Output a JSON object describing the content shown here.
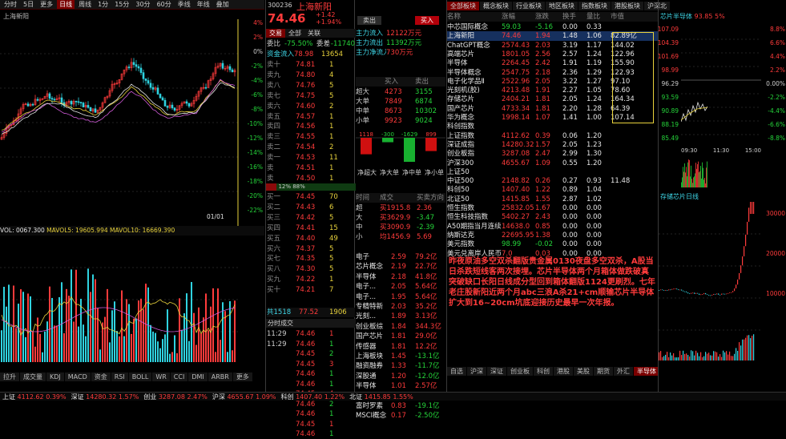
{
  "toolbar": {
    "tabs": [
      "分时",
      "5日",
      "更多",
      "日线",
      "周线",
      "1分",
      "15分",
      "30分",
      "60分",
      "季线",
      "年线"
    ],
    "active": "日线",
    "label": "叠加"
  },
  "chart": {
    "stock_label": "上海新阳",
    "volume_label": "VOL: 0067.300",
    "ma_labels": "MAVOL5: 19605.994 MAVOL10: 16669.390",
    "right_axis": [
      "4%",
      "2%",
      "0%",
      "-2%",
      "-4%",
      "-6%",
      "-8%",
      "-10%",
      "-12%",
      "-14%",
      "-16%",
      "-18%",
      "-20%",
      "-22%"
    ],
    "date_tag": "01/01",
    "bottom_tabs": [
      "拉升",
      "成交量",
      "KDJ",
      "MACD",
      "资金",
      "RSI",
      "BOLL",
      "WR",
      "CCI",
      "DMI",
      "ARBR",
      "更多"
    ],
    "price_tag": "112.62"
  },
  "quote": {
    "code": "300236",
    "name": "上海新阳",
    "price": "74.46",
    "change": "+1.42",
    "pct": "+1.94%",
    "btn_buy": "买入",
    "btn_sell": "卖出",
    "tabs": [
      "交易",
      "全部",
      "关联"
    ],
    "ratio_label": "委比",
    "ratio": "-75.50%",
    "diff_label": "委差",
    "diff": "-11740",
    "board_label": "资金流入",
    "board_value": "78.98",
    "vol_label": "13654",
    "flow_rows": [
      {
        "label": "主力流入",
        "val": "12122万元"
      },
      {
        "label": "主力流出",
        "val": "11392万元"
      },
      {
        "label": "主力净流入",
        "val": "730万元"
      }
    ],
    "asks": [
      {
        "l": "卖十",
        "p": "74.81",
        "v": "1"
      },
      {
        "l": "卖九",
        "p": "74.80",
        "v": "4"
      },
      {
        "l": "卖八",
        "p": "74.76",
        "v": "5"
      },
      {
        "l": "卖七",
        "p": "74.75",
        "v": "5"
      },
      {
        "l": "卖六",
        "p": "74.60",
        "v": "2"
      },
      {
        "l": "卖五",
        "p": "74.57",
        "v": "1"
      },
      {
        "l": "卖四",
        "p": "74.56",
        "v": "1"
      },
      {
        "l": "卖三",
        "p": "74.55",
        "v": "1"
      },
      {
        "l": "卖二",
        "p": "74.54",
        "v": "2"
      },
      {
        "l": "卖一",
        "p": "74.53",
        "v": "11"
      },
      {
        "l": "卖",
        "p": "74.51",
        "v": "1"
      },
      {
        "l": "卖",
        "p": "74.50",
        "v": "1"
      }
    ],
    "bids": [
      {
        "l": "买一",
        "p": "74.45",
        "v": "70"
      },
      {
        "l": "买二",
        "p": "74.43",
        "v": "6"
      },
      {
        "l": "买三",
        "p": "74.42",
        "v": "5"
      },
      {
        "l": "买四",
        "p": "74.41",
        "v": "15"
      },
      {
        "l": "买五",
        "p": "74.40",
        "v": "49"
      },
      {
        "l": "买六",
        "p": "74.37",
        "v": "5"
      },
      {
        "l": "买七",
        "p": "74.35",
        "v": "5"
      },
      {
        "l": "买八",
        "p": "74.30",
        "v": "5"
      },
      {
        "l": "买九",
        "p": "74.22",
        "v": "1"
      },
      {
        "l": "买十",
        "p": "74.21",
        "v": "7"
      }
    ],
    "mid_bar": "12% 88%",
    "sum_label": "共1518",
    "sum_p": "77.52",
    "sum_v": "1906",
    "trade_label": "分时成交",
    "trades": [
      {
        "t": "11:29",
        "p": "74.46",
        "v": "1"
      },
      {
        "t": "11:29",
        "p": "74.46",
        "v": "1"
      },
      {
        "t": "",
        "p": "74.45",
        "v": "2"
      },
      {
        "t": "",
        "p": "74.45",
        "v": "3"
      },
      {
        "t": "",
        "p": "74.46",
        "v": "1"
      },
      {
        "t": "",
        "p": "74.46",
        "v": "1"
      },
      {
        "t": "",
        "p": "74.45",
        "v": "4"
      },
      {
        "t": "",
        "p": "74.46",
        "v": "2"
      },
      {
        "t": "",
        "p": "74.46",
        "v": "1"
      },
      {
        "t": "",
        "p": "74.45",
        "v": "1"
      },
      {
        "t": "",
        "p": "74.46",
        "v": "1"
      }
    ]
  },
  "flow": {
    "header": [
      "买入",
      "卖出"
    ],
    "rows": [
      {
        "l": "超大",
        "a": "4273",
        "b": "3155"
      },
      {
        "l": "大单",
        "a": "7849",
        "b": "6874"
      },
      {
        "l": "中单",
        "a": "8673",
        "b": "10302"
      },
      {
        "l": "小单",
        "a": "9923",
        "b": "9024"
      }
    ],
    "bars": [
      {
        "label": "1118",
        "v": "1118"
      },
      {
        "label": "-300",
        "v": "-300"
      },
      {
        "label": "-1629",
        "v": "-1629"
      },
      {
        "label": "899",
        "v": "899"
      }
    ],
    "bar_labels": [
      "净超大",
      "净大单",
      "净中单",
      "净小单"
    ],
    "dir_header": [
      "时间",
      "成交",
      "买卖方向"
    ],
    "dir_rows": [
      {
        "a": "超",
        "b": "买1915.8",
        "c": "2.36"
      },
      {
        "a": "大",
        "b": "买3629.9",
        "c": "-3.47"
      },
      {
        "a": "中",
        "b": "买3090.9",
        "c": "-2.39"
      },
      {
        "a": "小",
        "b": "均1456.9",
        "c": "5.69"
      }
    ],
    "sector_rows": [
      {
        "n": "电子",
        "a": "2.59",
        "b": "79.2亿"
      },
      {
        "n": "芯片概念",
        "a": "2.19",
        "b": "22.7亿"
      },
      {
        "n": "半导体",
        "a": "2.18",
        "b": "41.8亿"
      },
      {
        "n": "电子...",
        "a": "2.05",
        "b": "5.64亿"
      },
      {
        "n": "电子...",
        "a": "1.95",
        "b": "5.64亿"
      },
      {
        "n": "专精特新",
        "a": "2.03",
        "b": "35.2亿"
      },
      {
        "n": "光刻...",
        "a": "1.89",
        "b": "3.13亿"
      },
      {
        "n": "创业板综",
        "a": "1.84",
        "b": "344.3亿"
      },
      {
        "n": "国产芯片",
        "a": "1.81",
        "b": "29.0亿"
      },
      {
        "n": "传感器",
        "a": "1.81",
        "b": "12.2亿"
      },
      {
        "n": "上海板块",
        "a": "1.45",
        "b": "-13.1亿"
      },
      {
        "n": "融资融券",
        "a": "1.33",
        "b": "-11.7亿"
      },
      {
        "n": "深股通",
        "a": "1.20",
        "b": "-12.0亿"
      },
      {
        "n": "半导体",
        "a": "1.01",
        "b": "2.57亿"
      },
      {
        "n": "小盘股",
        "a": "0.97",
        "b": "-15.5亿"
      },
      {
        "n": "富时罗素",
        "a": "0.83",
        "b": "-19.1亿"
      },
      {
        "n": "MSCI概念",
        "a": "0.17",
        "b": "-2.50亿"
      }
    ]
  },
  "sectors": {
    "tabs": [
      "全部板块",
      "概念板块",
      "行业板块",
      "地区板块",
      "指数板块",
      "港股板块",
      "沪深北"
    ],
    "header": [
      "名称",
      "涨幅",
      "涨跌",
      "换手",
      "量比",
      "市值"
    ],
    "rows": [
      {
        "n": "中芯国际概念",
        "a": "59.03",
        "b": "-5.16",
        "c": "0.00",
        "d": "0.33",
        "e": ""
      },
      {
        "n": "上海新阳",
        "a": "74.46",
        "b": "1.94",
        "c": "1.48",
        "d": "1.06",
        "e": "82.89亿"
      },
      {
        "n": "ChatGPT概念",
        "a": "2574.43",
        "b": "2.03",
        "c": "3.19",
        "d": "1.17",
        "e": "144.02"
      },
      {
        "n": "高端芯片",
        "a": "1801.05",
        "b": "2.56",
        "c": "2.57",
        "d": "1.24",
        "e": "122.96"
      },
      {
        "n": "半导体",
        "a": "2264.45",
        "b": "2.42",
        "c": "1.91",
        "d": "1.19",
        "e": "155.90"
      },
      {
        "n": "半导体概念",
        "a": "2547.75",
        "b": "2.18",
        "c": "2.36",
        "d": "1.29",
        "e": "122.93"
      },
      {
        "n": "电子化学品Ⅱ",
        "a": "2522.96",
        "b": "2.05",
        "c": "3.22",
        "d": "1.27",
        "e": "97.10"
      },
      {
        "n": "光刻机(胶)",
        "a": "4213.48",
        "b": "1.91",
        "c": "2.27",
        "d": "1.05",
        "e": "78.60"
      },
      {
        "n": "存储芯片",
        "a": "2404.21",
        "b": "1.81",
        "c": "2.05",
        "d": "1.24",
        "e": "164.34"
      },
      {
        "n": "国产芯片",
        "a": "4733.34",
        "b": "1.81",
        "c": "2.20",
        "d": "1.28",
        "e": "64.39"
      },
      {
        "n": "华为概念",
        "a": "1998.14",
        "b": "1.07",
        "c": "1.41",
        "d": "1.00",
        "e": "107.14"
      },
      {
        "n": "科创指数",
        "a": "",
        "b": "",
        "c": "",
        "d": "",
        "e": ""
      },
      {
        "n": "上证指数",
        "a": "4112.62",
        "b": "0.39",
        "c": "0.06",
        "d": "1.20",
        "e": ""
      },
      {
        "n": "深证成指",
        "a": "14280.32",
        "b": "1.57",
        "c": "2.05",
        "d": "1.23",
        "e": ""
      },
      {
        "n": "创业板指",
        "a": "3287.08",
        "b": "2.47",
        "c": "2.99",
        "d": "1.30",
        "e": ""
      },
      {
        "n": "沪深300",
        "a": "4655.67",
        "b": "1.09",
        "c": "0.55",
        "d": "1.20",
        "e": ""
      },
      {
        "n": "上证50",
        "a": "",
        "b": "",
        "c": "",
        "d": "",
        "e": ""
      },
      {
        "n": "中证500",
        "a": "2148.82",
        "b": "0.26",
        "c": "0.27",
        "d": "0.93",
        "e": "11.48"
      },
      {
        "n": "科创50",
        "a": "1407.40",
        "b": "1.22",
        "c": "0.89",
        "d": "1.04",
        "e": ""
      },
      {
        "n": "北证50",
        "a": "1415.85",
        "b": "1.55",
        "c": "2.87",
        "d": "1.02",
        "e": ""
      },
      {
        "n": "恒生指数",
        "a": "25832.05",
        "b": "1.67",
        "d": "0.00",
        "c": "0.00",
        "e": ""
      },
      {
        "n": "恒生科技指数",
        "a": "5402.27",
        "b": "2.43",
        "c": "0.00",
        "d": "0.00",
        "e": ""
      },
      {
        "n": "A50期指当月连续",
        "a": "14638.0",
        "b": "0.85",
        "c": "0.00",
        "d": "0.00",
        "e": ""
      },
      {
        "n": "纳斯达克",
        "a": "22695.95",
        "b": "1.38",
        "c": "0.00",
        "d": "0.00",
        "e": ""
      },
      {
        "n": "美元指数",
        "a": "98.99",
        "b": "-0.02",
        "c": "0.00",
        "d": "0.00",
        "e": ""
      },
      {
        "n": "美元兑离岸人民币",
        "a": "7.0",
        "b": "0.03",
        "c": "0.00",
        "d": "0.00",
        "e": ""
      }
    ],
    "bottom_tabs": [
      "自选",
      "沪深",
      "深证",
      "创业板",
      "科创",
      "港股",
      "美股",
      "期货",
      "外汇",
      "半导体",
      "更多"
    ],
    "annotation": "昨夜原油多空双杀翻版贵金属0130夜盘多空双杀，A股当日杀跌短线客两次接埋。芯片半导体两个月箱体做跌破真突破缺口长阳日线成分型回到箱体翻版1124更刷烈。七年老庄股新阳近两个月abc三浪A杀21+cm顺输芯片半导体扩大到16~20cm坑底迎接历史最早一次年报。"
  },
  "mini": {
    "title": "芯片半导体",
    "value": "93.85",
    "pct": "5%",
    "right_axis": [
      "8.8%",
      "6.6%",
      "4.4%",
      "2.2%",
      "0.00%",
      "-2.2%",
      "-4.4%",
      "-6.6%",
      "-8.8%"
    ],
    "left_axis": [
      "107.09",
      "104.39",
      "101.69",
      "98.99",
      "96.29",
      "93.59",
      "90.89",
      "88.19",
      "85.49"
    ],
    "time_labels": [
      "09:30",
      "11:30",
      "15:00"
    ],
    "sub_title": "存储芯片日线",
    "sub_axis": [
      "30000",
      "20000",
      "10000"
    ]
  },
  "status": {
    "items": [
      {
        "t": "上证",
        "v": "4112.62",
        "c": "0.39%"
      },
      {
        "t": "深证",
        "v": "14280.32",
        "c": "1.57%"
      },
      {
        "t": "创业",
        "v": "3287.08",
        "c": "2.47%"
      },
      {
        "t": "沪深",
        "v": "4655.67",
        "c": "1.09%"
      },
      {
        "t": "科创",
        "v": "1407.40",
        "c": "1.22%"
      },
      {
        "t": "北证",
        "v": "1415.85",
        "c": "1.55%"
      }
    ]
  }
}
